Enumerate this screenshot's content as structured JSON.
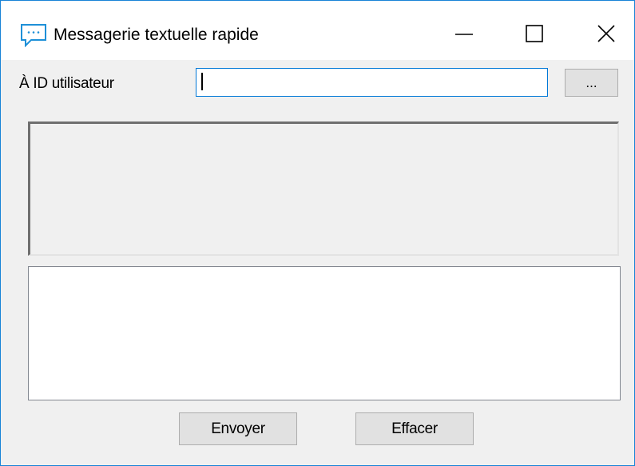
{
  "window": {
    "title": "Messagerie textuelle rapide",
    "icon": "chat-bubble-icon",
    "controls": {
      "minimize_icon": "minimize-icon",
      "maximize_icon": "maximize-icon",
      "close_icon": "close-icon"
    },
    "colors": {
      "border": "#1883d7",
      "titlebar": "#ffffff",
      "client_background": "#f0f0f0",
      "icon_accent": "#1e90d8"
    }
  },
  "recipient": {
    "label": "À ID utilisateur",
    "value": "",
    "browse_label": "..."
  },
  "history": {
    "text": ""
  },
  "compose": {
    "value": ""
  },
  "actions": {
    "send_label": "Envoyer",
    "clear_label": "Effacer"
  }
}
